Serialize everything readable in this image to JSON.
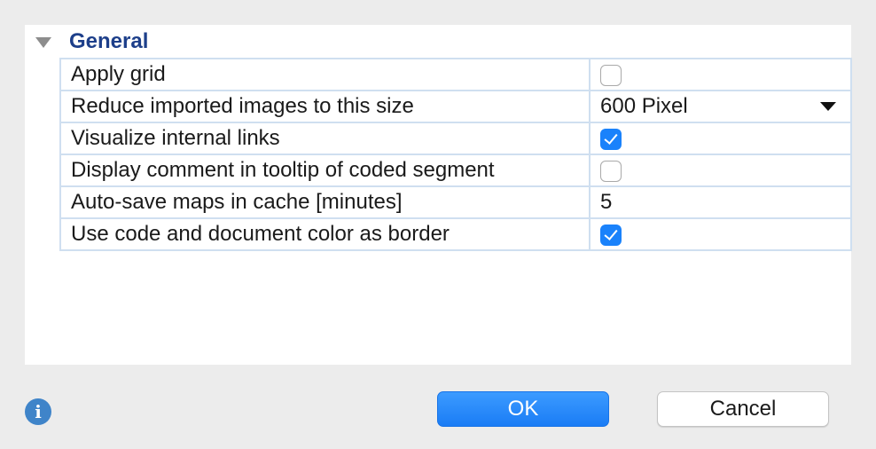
{
  "section": {
    "title": "General",
    "expanded": true
  },
  "rows": [
    {
      "label": "Apply grid",
      "type": "checkbox",
      "checked": false
    },
    {
      "label": "Reduce imported images to this size",
      "type": "select",
      "value": "600 Pixel"
    },
    {
      "label": "Visualize internal links",
      "type": "checkbox",
      "checked": true
    },
    {
      "label": "Display comment in tooltip of coded segment",
      "type": "checkbox",
      "checked": false
    },
    {
      "label": "Auto-save maps in cache [minutes]",
      "type": "text",
      "value": "5"
    },
    {
      "label": "Use code and document color as border",
      "type": "checkbox",
      "checked": true
    }
  ],
  "footer": {
    "info_icon": "info-icon",
    "ok_label": "OK",
    "cancel_label": "Cancel"
  },
  "colors": {
    "accent": "#1a82fb",
    "section_title": "#1d3f8a",
    "grid_border": "#cfdff0",
    "info_icon": "#3f84c9"
  }
}
